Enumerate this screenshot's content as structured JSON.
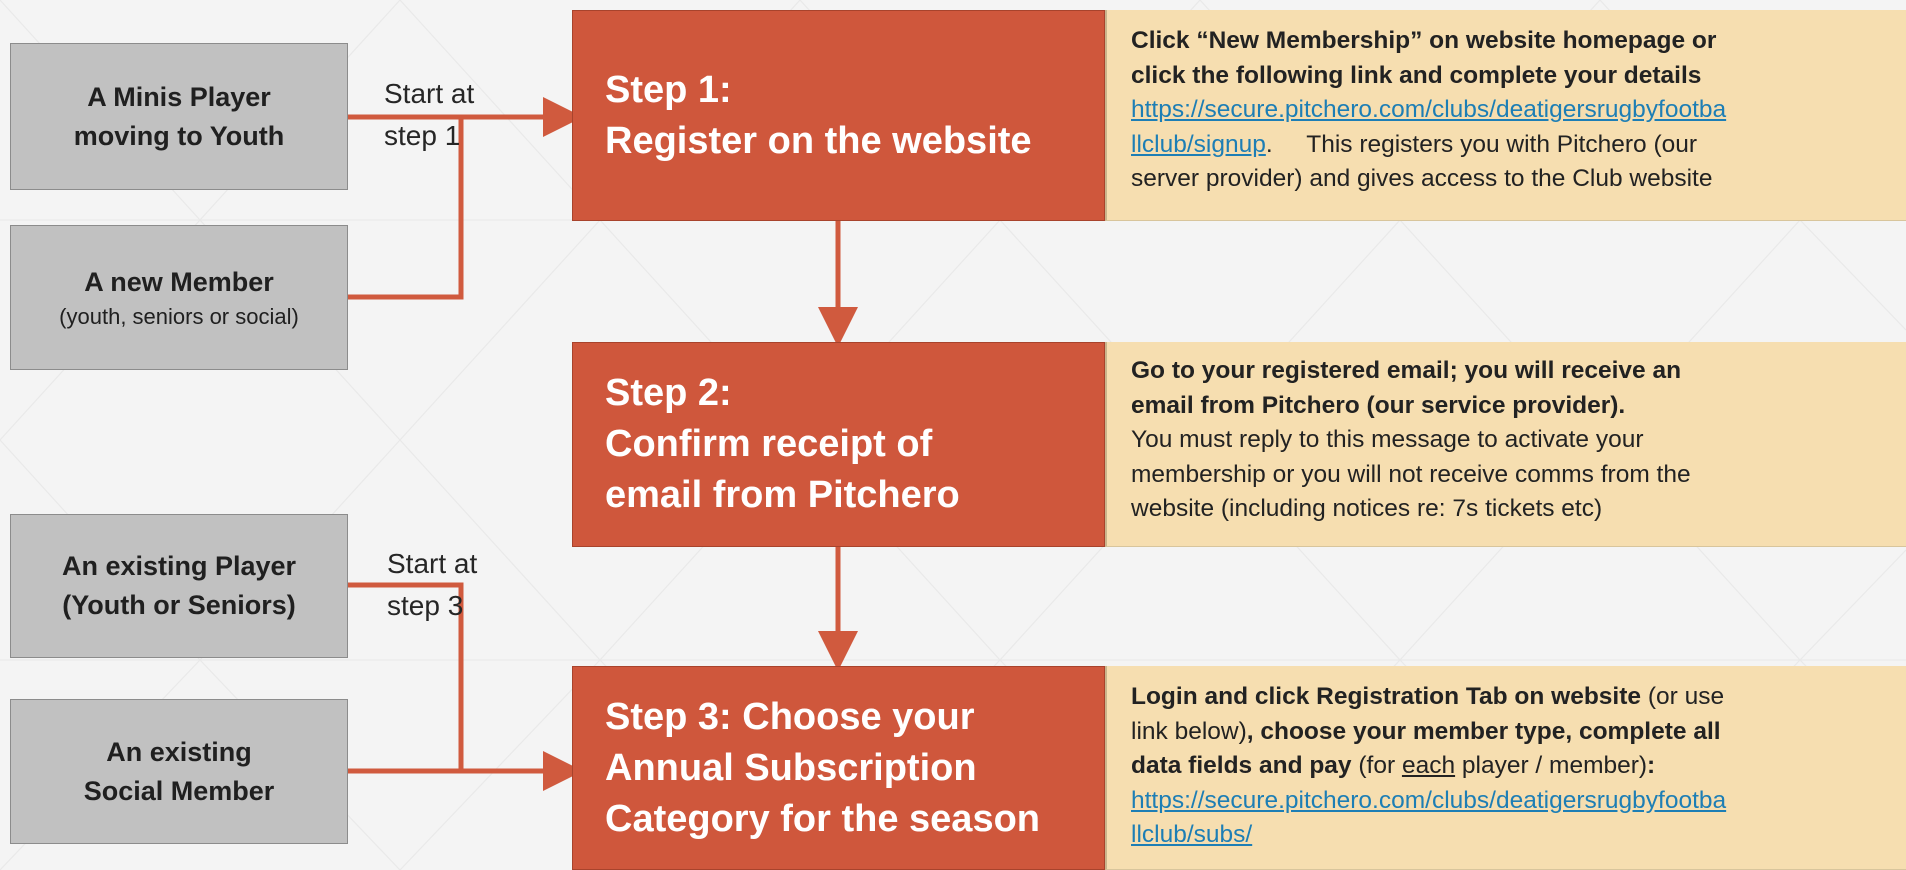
{
  "sources": [
    {
      "main_lines": [
        "A Minis Player",
        "moving to Youth"
      ],
      "sub": ""
    },
    {
      "main_lines": [
        "A new Member"
      ],
      "sub": "(youth, seniors or social)"
    },
    {
      "main_lines": [
        "An existing Player",
        "(Youth or Seniors)"
      ],
      "sub": ""
    },
    {
      "main_lines": [
        "An existing",
        "Social Member"
      ],
      "sub": ""
    }
  ],
  "entry_labels": [
    {
      "lines": [
        "Start at",
        "step 1"
      ]
    },
    {
      "lines": [
        "Start at",
        "step 3"
      ]
    }
  ],
  "steps": [
    {
      "lines": [
        "Step 1:",
        "Register on the website"
      ]
    },
    {
      "lines": [
        "Step 2:",
        "Confirm receipt of",
        "email from Pitchero"
      ]
    },
    {
      "lines": [
        "Step 3: Choose your",
        "Annual Subscription",
        "Category for the season"
      ]
    }
  ],
  "details": [
    {
      "bold_line_1": "Click “New Membership” on website homepage or",
      "bold_line_2": "click the following link and complete your details",
      "link_part_1": "https://secure.pitchero.com/clubs/deatigersrugbyfootba",
      "link_part_2": "llclub/signup",
      "text_after_link": ".     This registers you with Pitchero (our",
      "last_line": "server provider) and gives access to the Club website"
    },
    {
      "bold_line_1": "Go to your registered email; you will receive an",
      "bold_line_2": "email from Pitchero (our service provider).",
      "line_3": "You must reply to this message to activate your",
      "line_4": "membership or you will not receive comms from the",
      "line_5": "website (including notices re: 7s tickets etc)"
    },
    {
      "l1_bold": "Login and click Registration Tab on website",
      "l1_text": " (or use",
      "l2_text": "link below)",
      "l2_bold": ", choose your member type, complete all",
      "l3_bold": "data fields and pay",
      "l3_text_1": " (for ",
      "l3_underlined": "each",
      "l3_text_2": " player / member)",
      "l3_end": ":",
      "link_part_1": "https://secure.pitchero.com/clubs/deatigersrugbyfootba",
      "link_part_2": "llclub/subs/"
    }
  ],
  "colors": {
    "step_fill": "#cf573c",
    "connector": "#d05a3e",
    "source_fill": "#c1c1c1",
    "detail_fill": "#f6deb0",
    "link": "#1d7eb5"
  }
}
